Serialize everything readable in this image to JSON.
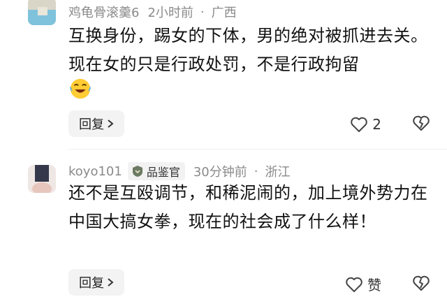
{
  "comments": [
    {
      "username": "鸡龟骨滚羹6",
      "time": "2小时前",
      "separator": "·",
      "location": "广西",
      "text": "互换身份，踢女的下体，男的绝对被抓进去关。现在女的只是行政处罚，不是行政拘留",
      "emoji": "laughing-crying-face",
      "reply_label": "回复",
      "like_count": "2"
    },
    {
      "username": "koyo101",
      "badge": "品鉴官",
      "time": "30分钟前",
      "separator": "·",
      "location": "浙江",
      "text": "还不是互殴调节，和稀泥闹的，加上境外势力在中国大搞女拳，现在的社会成了什么样！",
      "reply_label": "回复",
      "like_label": "赞"
    }
  ],
  "icons": {
    "reply_chevron": "chevron-right-icon",
    "like": "heart-outline-icon",
    "dislike": "broken-heart-icon",
    "badge": "badge-icon"
  }
}
